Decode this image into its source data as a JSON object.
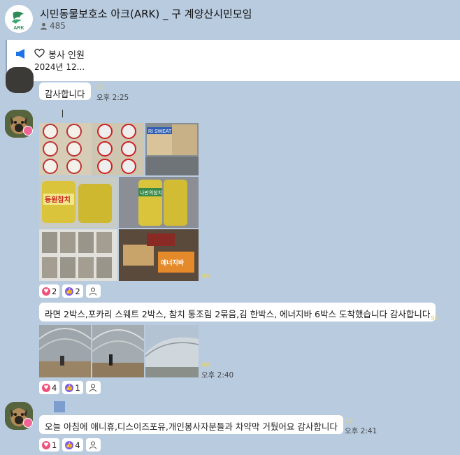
{
  "header": {
    "logo_text": "ARK",
    "title": "시민동물보호소 아크(ARK) _ 구 계양산시민모임",
    "member_count": "485"
  },
  "notice": {
    "line1": "봉사 인원",
    "line2": "2024년 12..."
  },
  "messages": [
    {
      "text": "감사합니다",
      "time": "오후 2:25"
    },
    {
      "text": "라면 2박스,포카리 스웨트 2박스, 참치 통조림 2묶음,김 한박스, 에너지바 6박스 도착했습니다 감사합니다"
    },
    {
      "time": "오후 2:40"
    },
    {
      "text": "오늘 아침에 애니휴,디스이즈포유,개인봉사자분들과 차약막 거뒀어요 감사합니다",
      "time": "오후 2:41"
    }
  ],
  "read_mark": "99",
  "reactions": {
    "photos1": {
      "heart": "2",
      "thumb": "2"
    },
    "photos2": {
      "heart": "4",
      "thumb": "1"
    },
    "msg3": {
      "heart": "1",
      "thumb": "4"
    }
  },
  "photo_labels": {
    "p4": "동원참치",
    "p5": "나만의참치",
    "p8": "에너지바",
    "p3": "RI SWEAT"
  },
  "colors": {
    "background": "#b9cbdf",
    "notice_accent": "#1e72e8",
    "heart": "#f0517a",
    "thumb": "#7a5cf0",
    "read_mark": "#e6d36c"
  }
}
